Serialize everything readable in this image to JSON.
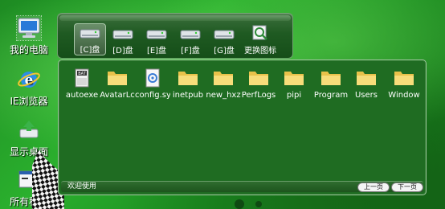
{
  "desktop": {
    "icons": [
      {
        "label": "我的电脑",
        "icon": "computer-icon"
      },
      {
        "label": "IE浏览器",
        "icon": "ie-browser-icon"
      },
      {
        "label": "显示桌面",
        "icon": "show-desktop-icon"
      },
      {
        "label": "所有程序",
        "icon": "programs-icon"
      }
    ]
  },
  "drivebar": {
    "drives": [
      {
        "label": "[C]盘",
        "icon": "drive-icon"
      },
      {
        "label": "[D]盘",
        "icon": "drive-icon"
      },
      {
        "label": "[E]盘",
        "icon": "drive-icon"
      },
      {
        "label": "[F]盘",
        "icon": "drive-icon"
      },
      {
        "label": "[G]盘",
        "icon": "drive-icon"
      },
      {
        "label": "更换图标",
        "icon": "change-icon-icon"
      }
    ]
  },
  "window": {
    "files": [
      {
        "name": "autoexe",
        "icon": "bat-file-icon"
      },
      {
        "name": "AvatarLc",
        "icon": "folder-icon"
      },
      {
        "name": "config.sy",
        "icon": "config-file-icon"
      },
      {
        "name": "inetpub",
        "icon": "folder-icon"
      },
      {
        "name": "new_hxz",
        "icon": "folder-icon"
      },
      {
        "name": "PerfLogs",
        "icon": "folder-icon"
      },
      {
        "name": "pipi",
        "icon": "folder-icon"
      },
      {
        "name": "Program",
        "icon": "folder-icon"
      },
      {
        "name": "Users",
        "icon": "folder-icon"
      },
      {
        "name": "Window",
        "icon": "folder-icon"
      }
    ],
    "status": "欢迎使用",
    "prev_label": "上一页",
    "next_label": "下一页"
  },
  "colors": {
    "background": "#1f8a24",
    "panel": "#1f6c22",
    "border": "#9ec39e"
  }
}
